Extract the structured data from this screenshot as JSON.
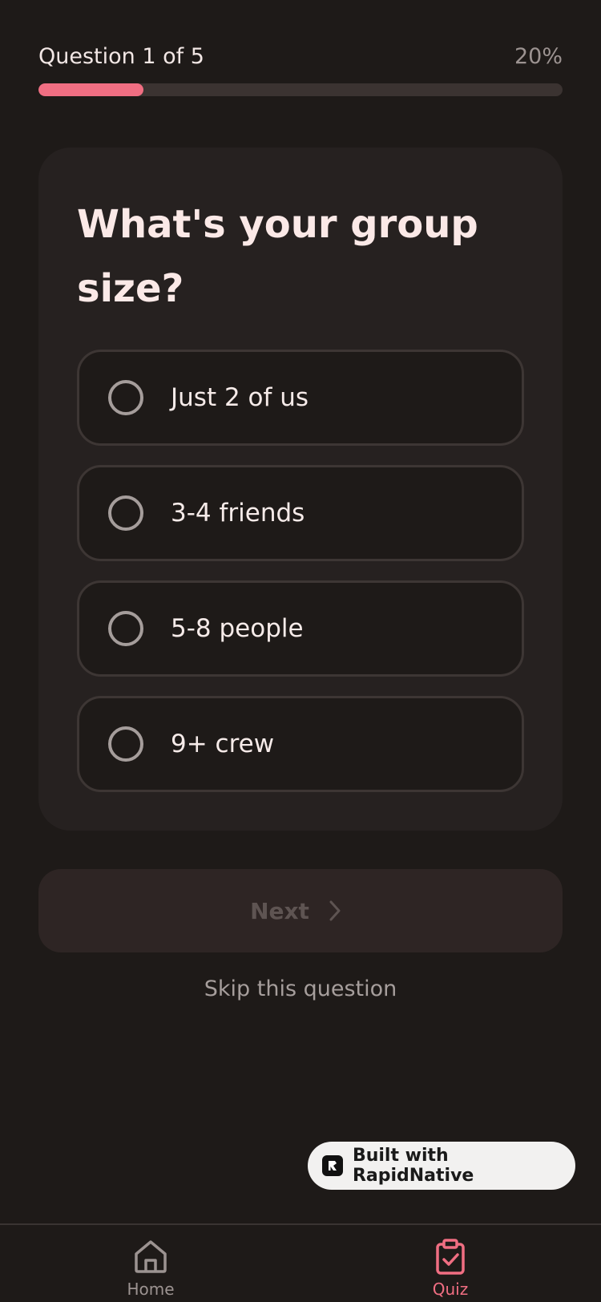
{
  "header": {
    "question_counter": "Question 1 of 5",
    "percent_label": "20%",
    "progress_fraction": 0.2
  },
  "question": {
    "title": "What's your group size?",
    "options": [
      {
        "label": "Just 2 of us",
        "selected": false
      },
      {
        "label": "3-4 friends",
        "selected": false
      },
      {
        "label": "5-8 people",
        "selected": false
      },
      {
        "label": "9+ crew",
        "selected": false
      }
    ]
  },
  "actions": {
    "next_label": "Next",
    "skip_label": "Skip this question"
  },
  "badge": {
    "text": "Built with RapidNative"
  },
  "tabs": [
    {
      "label": "Home",
      "icon": "home-icon",
      "active": false
    },
    {
      "label": "Quiz",
      "icon": "clipboard-check-icon",
      "active": true
    }
  ],
  "colors": {
    "background": "#1e1a18",
    "accent": "#f06e82",
    "card": "#262120"
  }
}
